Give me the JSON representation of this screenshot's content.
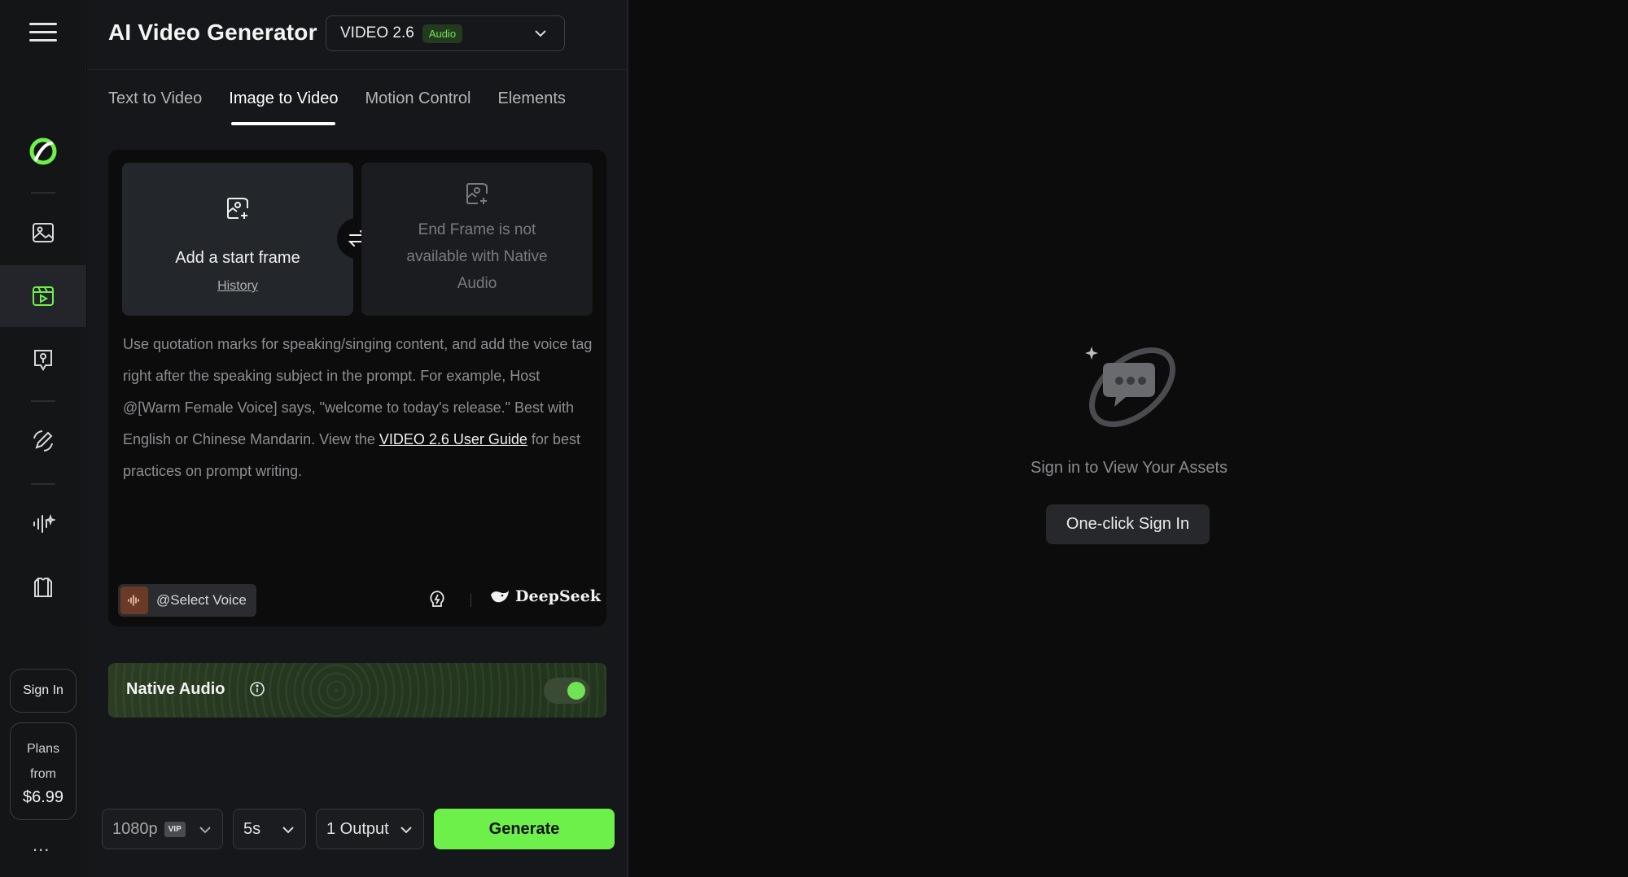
{
  "app": {
    "title": "AI Video Generator"
  },
  "model": {
    "name": "VIDEO 2.6",
    "badge": "Audio"
  },
  "tabs": [
    {
      "label": "Text to Video"
    },
    {
      "label": "Image to Video",
      "active": true
    },
    {
      "label": "Motion Control"
    },
    {
      "label": "Elements"
    }
  ],
  "rail": {
    "icons": [
      "menu-icon",
      "logo-icon",
      "image-icon",
      "video-icon",
      "avatar-icon",
      "edit-icon",
      "audio-icon",
      "shirt-icon"
    ],
    "sign_in": "Sign In",
    "plans": {
      "line1": "Plans",
      "line2": "from",
      "price": "$6.99"
    },
    "more": "..."
  },
  "frames": {
    "start": {
      "label": "Add a start frame",
      "history": "History"
    },
    "end": {
      "text": "End Frame is not available with Native Audio"
    }
  },
  "prompt": {
    "text_before": "Use quotation marks for speaking/singing content, and add the voice tag right after the speaking subject in the prompt. For example, Host @[Warm Female Voice] says, \"welcome to today's release.\" Best with English or Chinese Mandarin. View the ",
    "link": "VIDEO 2.6 User Guide",
    "text_after": " for best practices on prompt writing."
  },
  "voice": {
    "label": "@Select Voice"
  },
  "deepseek": {
    "label": "DeepSeek"
  },
  "native_audio": {
    "label": "Native Audio",
    "enabled": true
  },
  "controls": {
    "resolution": "1080p",
    "vip": "VIP",
    "duration": "5s",
    "outputs": "1 Output",
    "generate": "Generate"
  },
  "assets": {
    "message": "Sign in to View Your Assets",
    "sign_in_button": "One-click Sign In"
  },
  "colors": {
    "accent": "#6ef04a",
    "badge_text": "#6ee35a",
    "background": "#0c0c0d"
  }
}
